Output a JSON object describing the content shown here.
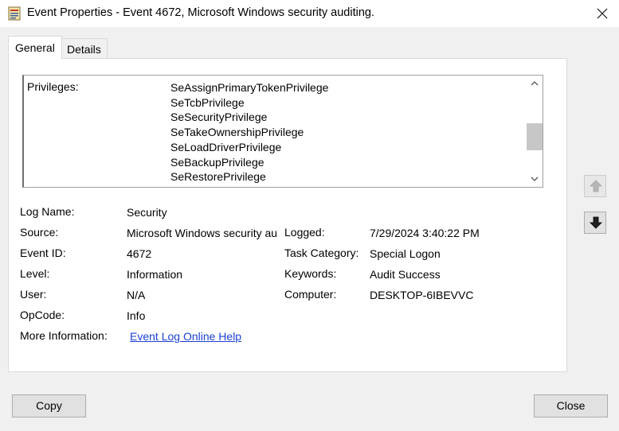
{
  "window": {
    "title": "Event Properties - Event 4672, Microsoft Windows security auditing.",
    "close_glyph": "✕"
  },
  "tabs": [
    {
      "label": "General",
      "selected": true
    },
    {
      "label": "Details",
      "selected": false
    }
  ],
  "description": {
    "label": "Privileges:",
    "privileges": [
      "SeAssignPrimaryTokenPrivilege",
      "SeTcbPrivilege",
      "SeSecurityPrivilege",
      "SeTakeOwnershipPrivilege",
      "SeLoadDriverPrivilege",
      "SeBackupPrivilege",
      "SeRestorePrivilege"
    ]
  },
  "fields": {
    "log_name_label": "Log Name:",
    "log_name": "Security",
    "source_label": "Source:",
    "source": "Microsoft Windows security auditing.",
    "event_id_label": "Event ID:",
    "event_id": "4672",
    "level_label": "Level:",
    "level": "Information",
    "user_label": "User:",
    "user": "N/A",
    "opcode_label": "OpCode:",
    "opcode": "Info",
    "more_info_label": "More Information:",
    "more_info_link": "Event Log Online Help",
    "logged_label": "Logged:",
    "logged": "7/29/2024 3:40:22 PM",
    "task_category_label": "Task Category:",
    "task_category": "Special Logon",
    "keywords_label": "Keywords:",
    "keywords": "Audit Success",
    "computer_label": "Computer:",
    "computer": "DESKTOP-6IBEVVC"
  },
  "buttons": {
    "copy": "Copy",
    "close": "Close"
  },
  "icons": {
    "scroll_up": "▲",
    "scroll_down": "▼"
  }
}
